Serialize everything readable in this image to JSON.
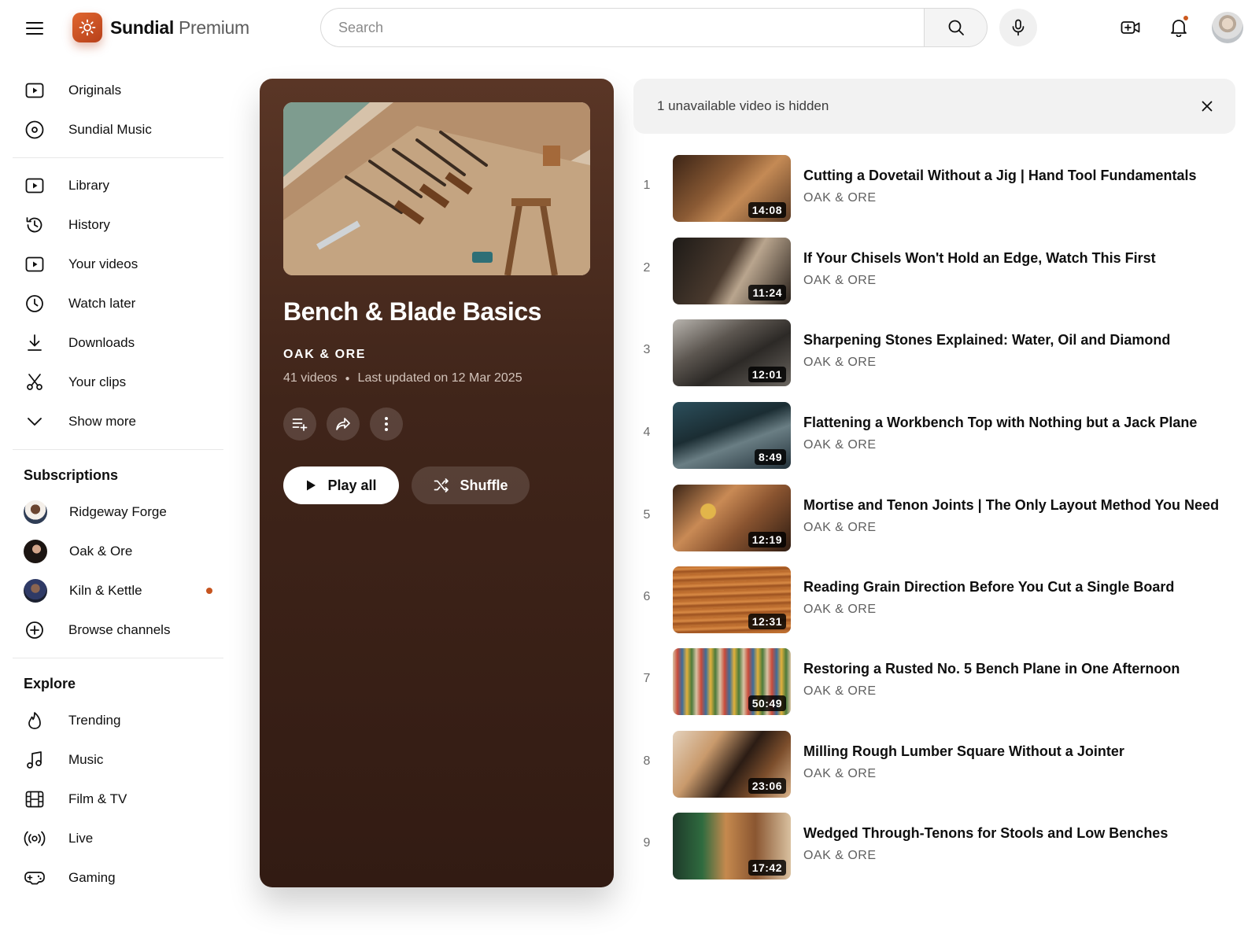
{
  "header": {
    "brand": "Sundial",
    "tier": "Premium",
    "search_placeholder": "Search"
  },
  "sidebar": {
    "top_items": [
      {
        "label": "Originals",
        "icon": "play-square-icon"
      },
      {
        "label": "Sundial Music",
        "icon": "disc-icon"
      }
    ],
    "library_items": [
      {
        "label": "Library",
        "icon": "library-icon"
      },
      {
        "label": "History",
        "icon": "history-icon"
      },
      {
        "label": "Your videos",
        "icon": "your-videos-icon"
      },
      {
        "label": "Watch later",
        "icon": "clock-icon"
      },
      {
        "label": "Downloads",
        "icon": "download-icon"
      },
      {
        "label": "Your clips",
        "icon": "scissors-icon"
      },
      {
        "label": "Show more",
        "icon": "chevron-down-icon"
      }
    ],
    "subscriptions_title": "Subscriptions",
    "subscriptions": [
      {
        "label": "Ridgeway Forge",
        "live": false
      },
      {
        "label": "Oak & Ore",
        "live": false
      },
      {
        "label": "Kiln & Kettle",
        "live": true
      }
    ],
    "browse_channels": "Browse channels",
    "explore_title": "Explore",
    "explore_items": [
      {
        "label": "Trending",
        "icon": "flame-icon"
      },
      {
        "label": "Music",
        "icon": "music-note-icon"
      },
      {
        "label": "Film & TV",
        "icon": "film-icon"
      },
      {
        "label": "Live",
        "icon": "live-broadcast-icon"
      },
      {
        "label": "Gaming",
        "icon": "gamepad-icon"
      }
    ]
  },
  "playlist": {
    "title": "Bench & Blade Basics",
    "channel": "OAK & ORE",
    "video_count": "41 videos",
    "updated": "Last updated on 12 Mar 2025",
    "play_all": "Play all",
    "shuffle": "Shuffle"
  },
  "hidden_notice": "1 unavailable video is hidden",
  "videos": [
    {
      "index": "1",
      "title": "Cutting a Dovetail Without a Jig | Hand Tool Fundamentals",
      "channel": "OAK & ORE",
      "duration": "14:08"
    },
    {
      "index": "2",
      "title": "If Your Chisels Won't Hold an Edge, Watch This First",
      "channel": "OAK & ORE",
      "duration": "11:24"
    },
    {
      "index": "3",
      "title": "Sharpening Stones Explained: Water, Oil and Diamond",
      "channel": "OAK & ORE",
      "duration": "12:01"
    },
    {
      "index": "4",
      "title": "Flattening a Workbench Top with Nothing but a Jack Plane",
      "channel": "OAK & ORE",
      "duration": "8:49"
    },
    {
      "index": "5",
      "title": "Mortise and Tenon Joints | The Only Layout Method You Need",
      "channel": "OAK & ORE",
      "duration": "12:19"
    },
    {
      "index": "6",
      "title": "Reading Grain Direction Before You Cut a Single Board",
      "channel": "OAK & ORE",
      "duration": "12:31"
    },
    {
      "index": "7",
      "title": "Restoring a Rusted No. 5 Bench Plane in One Afternoon",
      "channel": "OAK & ORE",
      "duration": "50:49"
    },
    {
      "index": "8",
      "title": "Milling Rough Lumber Square Without a Jointer",
      "channel": "OAK & ORE",
      "duration": "23:06"
    },
    {
      "index": "9",
      "title": "Wedged Through-Tenons for Stools and Low Benches",
      "channel": "OAK & ORE",
      "duration": "17:42"
    }
  ],
  "colors": {
    "brand_accent": "#cc5a1e",
    "card_top": "#5a3626",
    "card_bottom": "#321b13"
  }
}
